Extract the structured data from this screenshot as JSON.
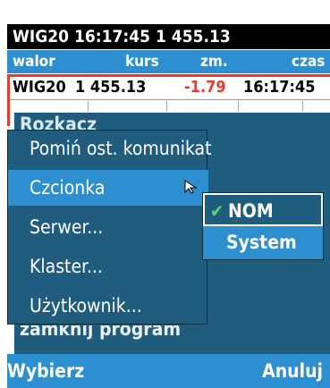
{
  "status_bar": {
    "text": "WIG20 16:17:45 1 455.13"
  },
  "columns": [
    "walor",
    "kurs",
    "zm.",
    "czas"
  ],
  "quote_row": {
    "symbol": "WIG20",
    "price": "1 455.13",
    "change": "-1.79",
    "time": "16:17:45"
  },
  "menu": {
    "header_partial": "Rozkacz",
    "items": [
      "Pomiń ost. komunikat",
      "Czcionka",
      "Serwer...",
      "Klaster...",
      "Użytkownik..."
    ],
    "active_index": 1,
    "footer_partial": "zamknij program"
  },
  "submenu": {
    "items": [
      "NOM",
      "System"
    ],
    "selected_index": 0
  },
  "softkeys": {
    "left": "Wybierz",
    "right": "Anuluj"
  },
  "colors": {
    "panel": "#1f5c7d",
    "accent": "#2d8fcf",
    "negative": "#e63b2e",
    "check": "#5fd66e"
  }
}
